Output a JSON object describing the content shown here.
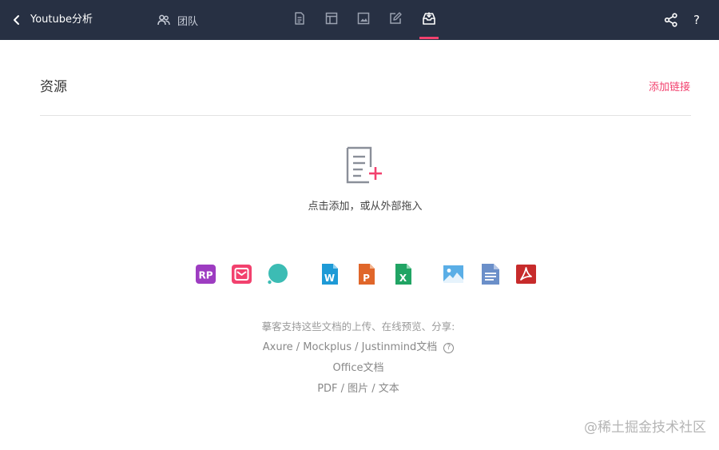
{
  "topbar": {
    "title": "Youtube分析",
    "team_label": "团队",
    "help_label": "?",
    "tools": [
      {
        "icon": "document-icon",
        "active": false
      },
      {
        "icon": "layout-icon",
        "active": false
      },
      {
        "icon": "image-icon",
        "active": false
      },
      {
        "icon": "edit-icon",
        "active": false
      },
      {
        "icon": "inbox-icon",
        "active": true
      }
    ]
  },
  "resources": {
    "title": "资源",
    "add_link": "添加链接",
    "empty_hint": "点击添加，或从外部拖入"
  },
  "file_types": [
    {
      "icon": "axure-rp-icon",
      "label": "RP",
      "color": "#9d3cc1"
    },
    {
      "icon": "mockplus-icon",
      "color": "#f2416e"
    },
    {
      "icon": "justinmind-icon",
      "color": "#3cbcb4"
    },
    {
      "icon": "word-icon",
      "label": "W",
      "color": "#1e9ad6"
    },
    {
      "icon": "powerpoint-icon",
      "label": "P",
      "color": "#e0662a"
    },
    {
      "icon": "excel-icon",
      "label": "X",
      "color": "#21a464"
    },
    {
      "icon": "image-file-icon",
      "color": "#5aaee6"
    },
    {
      "icon": "text-file-icon",
      "color": "#6b8fc9"
    },
    {
      "icon": "pdf-icon",
      "color": "#c72b2b"
    }
  ],
  "support": {
    "intro": "摹客支持这些文档的上传、在线预览、分享:",
    "prototype_line": "Axure / Mockplus / Justinmind文档",
    "help_mark": "?",
    "office_line": "Office文档",
    "other_line": "PDF / 图片 / 文本"
  },
  "watermark": "@稀土掘金技术社区",
  "colors": {
    "accent": "#f2416e",
    "topbar": "#273043"
  }
}
